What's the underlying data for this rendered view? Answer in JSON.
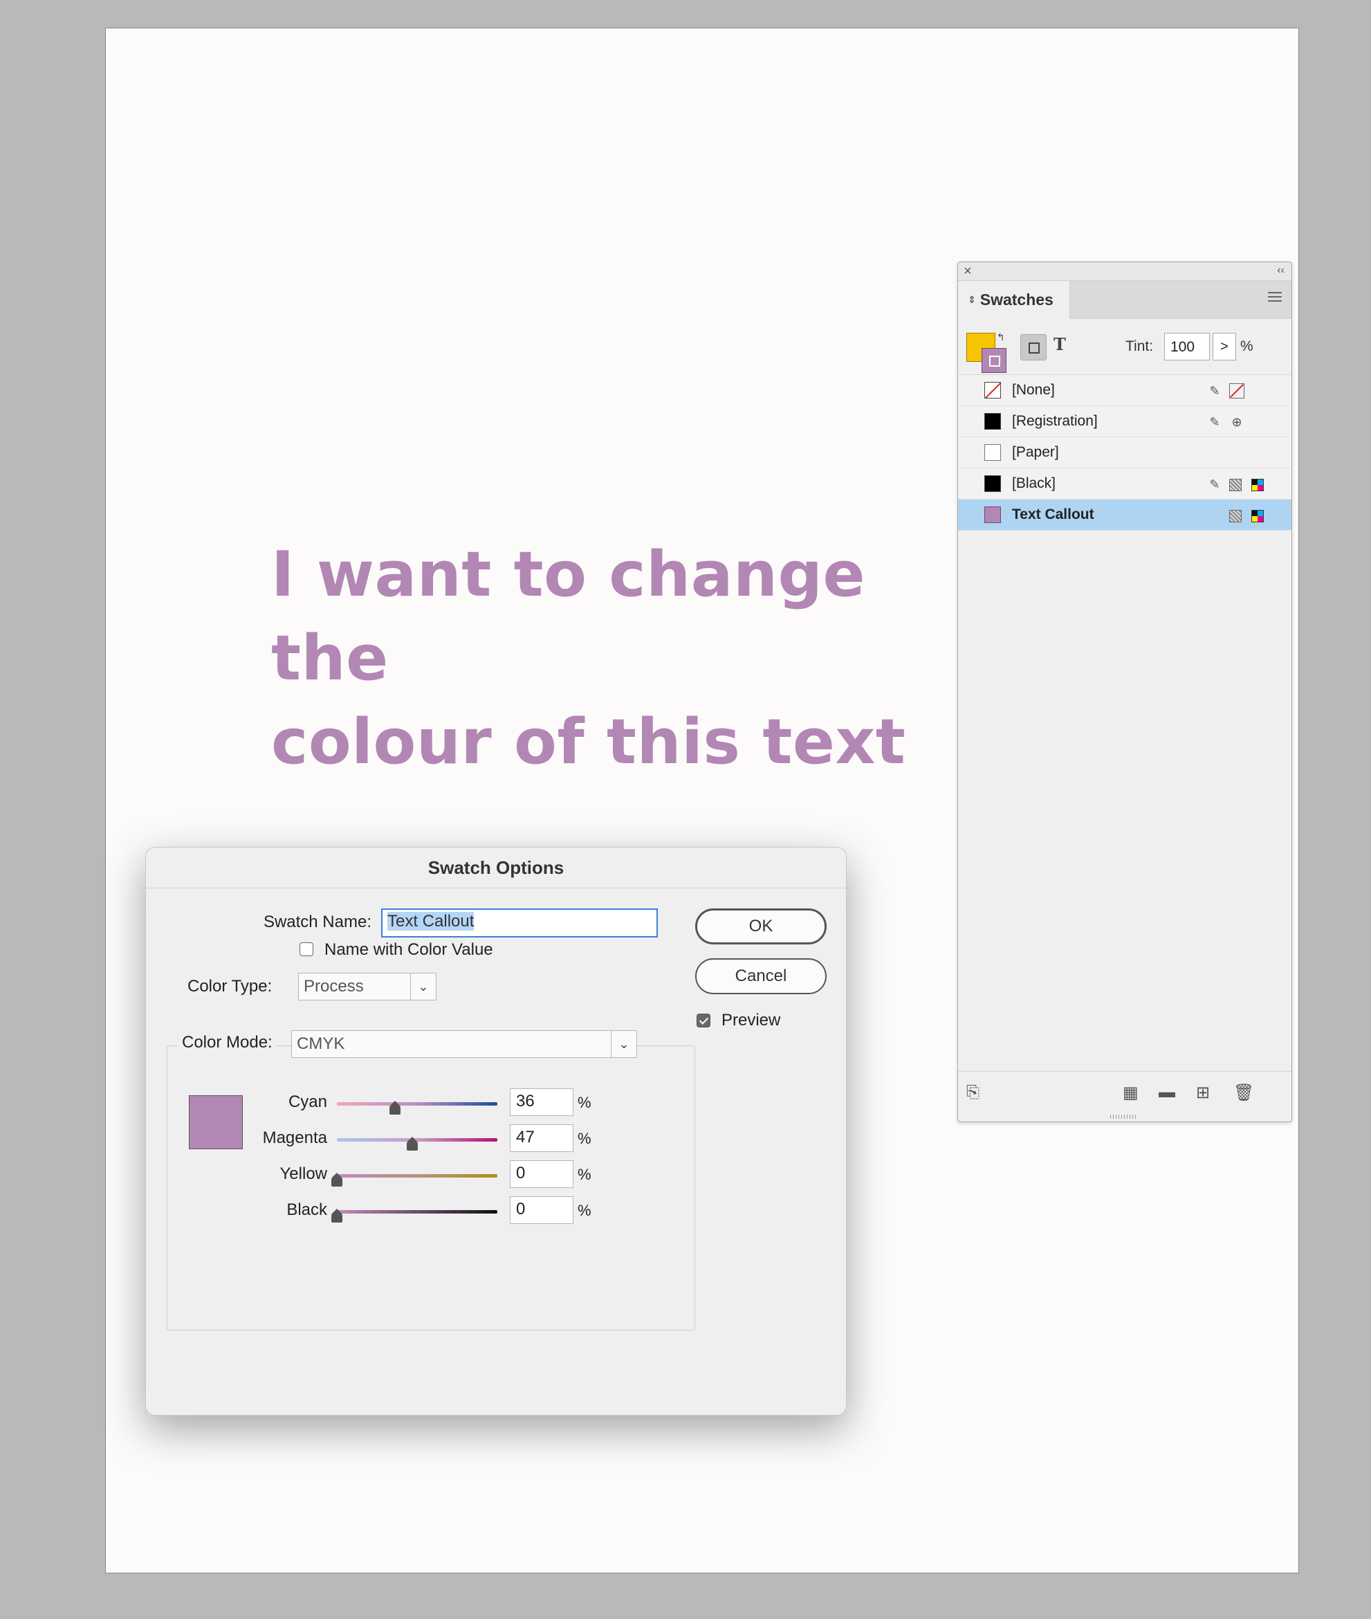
{
  "document": {
    "headline_line1": "I want to change the",
    "headline_line2": "colour of this text",
    "text_color": "#b287b4"
  },
  "swatches_panel": {
    "close_icon": "close-icon",
    "collapse_icon": "double-chevron-left-icon",
    "tab_label": "Swatches",
    "tint_label": "Tint:",
    "tint_value": "100",
    "tint_step": ">",
    "tint_unit": "%",
    "fill_color": "#f7c400",
    "stroke_color": "#b287b4",
    "items": [
      {
        "name": "[None]",
        "chip": "none",
        "selected": false
      },
      {
        "name": "[Registration]",
        "chip": "#000000",
        "selected": false
      },
      {
        "name": "[Paper]",
        "chip": "#ffffff",
        "selected": false
      },
      {
        "name": "[Black]",
        "chip": "#000000",
        "selected": false
      },
      {
        "name": "Text Callout",
        "chip": "#b287b4",
        "selected": true
      }
    ]
  },
  "dialog": {
    "title": "Swatch Options",
    "swatch_name_label": "Swatch Name:",
    "swatch_name_value": "Text Callout",
    "name_with_color_label": "Name with Color Value",
    "name_with_color_checked": false,
    "color_type_label": "Color Type:",
    "color_type_value": "Process",
    "color_mode_label": "Color Mode:",
    "color_mode_value": "CMYK",
    "ok_label": "OK",
    "cancel_label": "Cancel",
    "preview_label": "Preview",
    "preview_checked": true,
    "preview_color": "#b287b4",
    "channels": [
      {
        "label": "Cyan",
        "value": "36",
        "unit": "%",
        "fraction": 0.36
      },
      {
        "label": "Magenta",
        "value": "47",
        "unit": "%",
        "fraction": 0.47
      },
      {
        "label": "Yellow",
        "value": "0",
        "unit": "%",
        "fraction": 0
      },
      {
        "label": "Black",
        "value": "0",
        "unit": "%",
        "fraction": 0
      }
    ]
  }
}
